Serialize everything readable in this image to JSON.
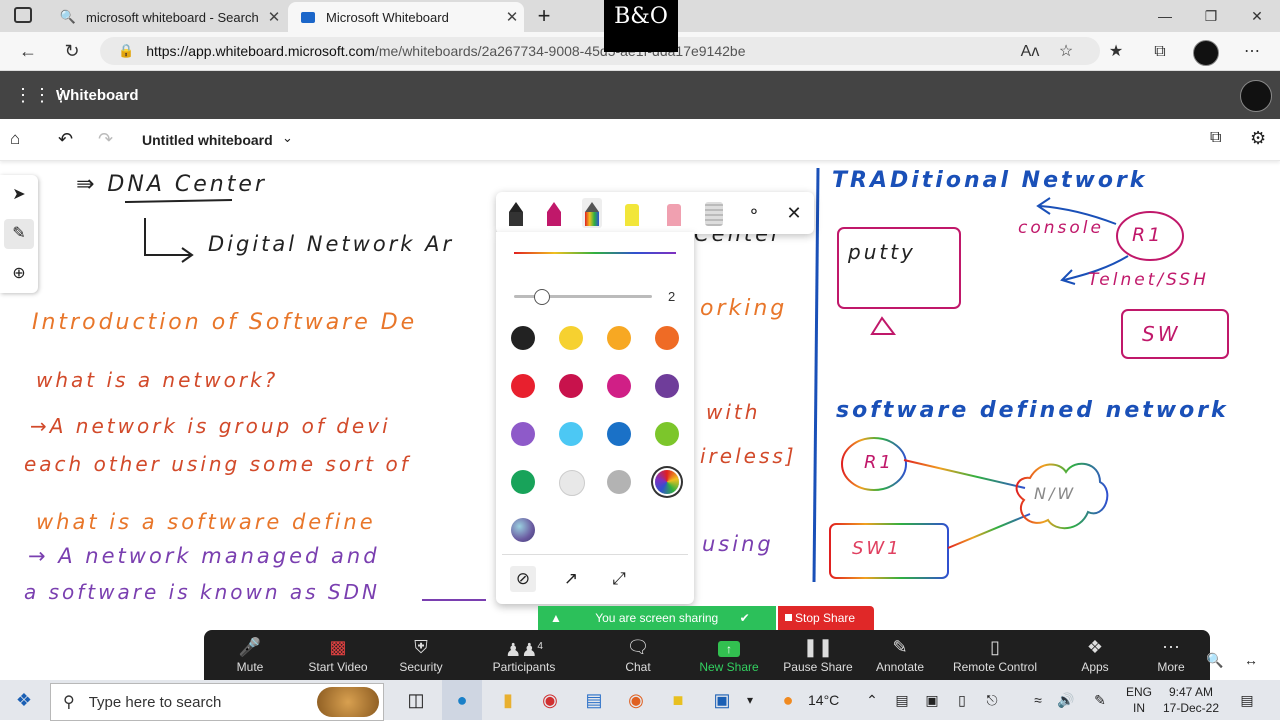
{
  "browser": {
    "tabs": [
      {
        "title": "microsoft whiteboard - Search",
        "icon": "search-icon"
      },
      {
        "title": "Microsoft Whiteboard",
        "icon": "whiteboard-icon"
      }
    ],
    "url_host": "https://app.whiteboard.microsoft.com",
    "url_path": "/me/whiteboards/2a267734-9008-45d5-ae1f-dda17e9142be",
    "overlay_logo": "B&O"
  },
  "app": {
    "name": "Whiteboard",
    "board_title": "Untitled whiteboard"
  },
  "canvas": {
    "dna_center": "⇛ DNA Center",
    "dna_full": "Digital Network Ar",
    "dna_tail": "Center",
    "intro_title": "Introduction of Software De",
    "intro_tail": "orking",
    "q1": "what is a network?",
    "a1_line1": "→A network is group of devi",
    "a1_line1_tail": "with",
    "a1_line2": "each other using some sort of",
    "a1_line2_tail": "ireless]",
    "q2": "what is a software define",
    "a2_line1": "→ A network managed and",
    "a2_line1_tail": "using",
    "a2_line2": "a software is known as SDN",
    "traditional_title": "TRADitional Network",
    "putty": "putty",
    "console": "console",
    "r1": "R1",
    "telnet": "Telnet/SSH",
    "sw": "SW",
    "sdn_title": "software defined network",
    "r1_sdn": "R1",
    "sw1": "SW1",
    "nw": "N/W"
  },
  "ink_toolbar": {
    "tools": [
      "black-pen",
      "magenta-pen",
      "rainbow-pen",
      "highlighter",
      "eraser",
      "ruler",
      "lasso-select"
    ],
    "stroke_size": "2",
    "colors": [
      "#222222",
      "#f6d130",
      "#f7a823",
      "#ef6b25",
      "#e8202e",
      "#c8124c",
      "#d01f86",
      "#6f3d9a",
      "#8e5ac9",
      "#4cc8f4",
      "#1a71c7",
      "#7cc62b",
      "#18a35a",
      "#e8e8e8",
      "#b3b3b3",
      "rainbow",
      "galaxy"
    ],
    "selected_color": "rainbow"
  },
  "zoom": {
    "banner": "You are screen sharing",
    "stop_share": "Stop Share",
    "buttons": [
      {
        "label": "Mute",
        "icon": "microphone-icon"
      },
      {
        "label": "Start Video",
        "icon": "video-off-icon"
      },
      {
        "label": "Security",
        "icon": "shield-icon"
      },
      {
        "label": "Participants",
        "icon": "participants-icon",
        "count": "4"
      },
      {
        "label": "Chat",
        "icon": "chat-icon"
      },
      {
        "label": "New Share",
        "icon": "share-screen-icon"
      },
      {
        "label": "Pause Share",
        "icon": "pause-icon"
      },
      {
        "label": "Annotate",
        "icon": "pencil-icon"
      },
      {
        "label": "Remote Control",
        "icon": "mouse-icon"
      },
      {
        "label": "Apps",
        "icon": "apps-icon"
      },
      {
        "label": "More",
        "icon": "more-icon"
      }
    ]
  },
  "taskbar": {
    "search_placeholder": "Type here to search",
    "temperature": "14°C",
    "language_line1": "ENG",
    "language_line2": "IN",
    "time": "9:47 AM",
    "date": "17-Dec-22"
  }
}
